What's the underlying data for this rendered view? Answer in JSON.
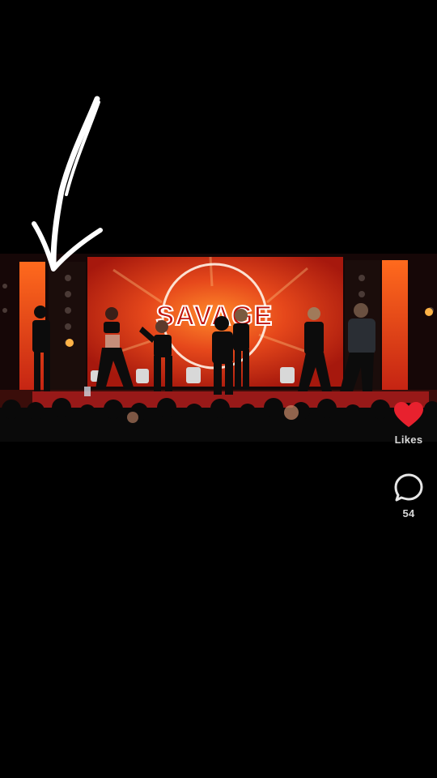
{
  "video": {
    "stage_sign_text": "SAVAGE"
  },
  "actions": {
    "like": {
      "label": "Likes",
      "icon": "heart-icon",
      "color": "#e8212e"
    },
    "comment": {
      "count": "54",
      "icon": "comment-bubble-icon"
    }
  },
  "overlay": {
    "icon": "hand-drawn-arrow-icon",
    "color": "#ffffff"
  }
}
